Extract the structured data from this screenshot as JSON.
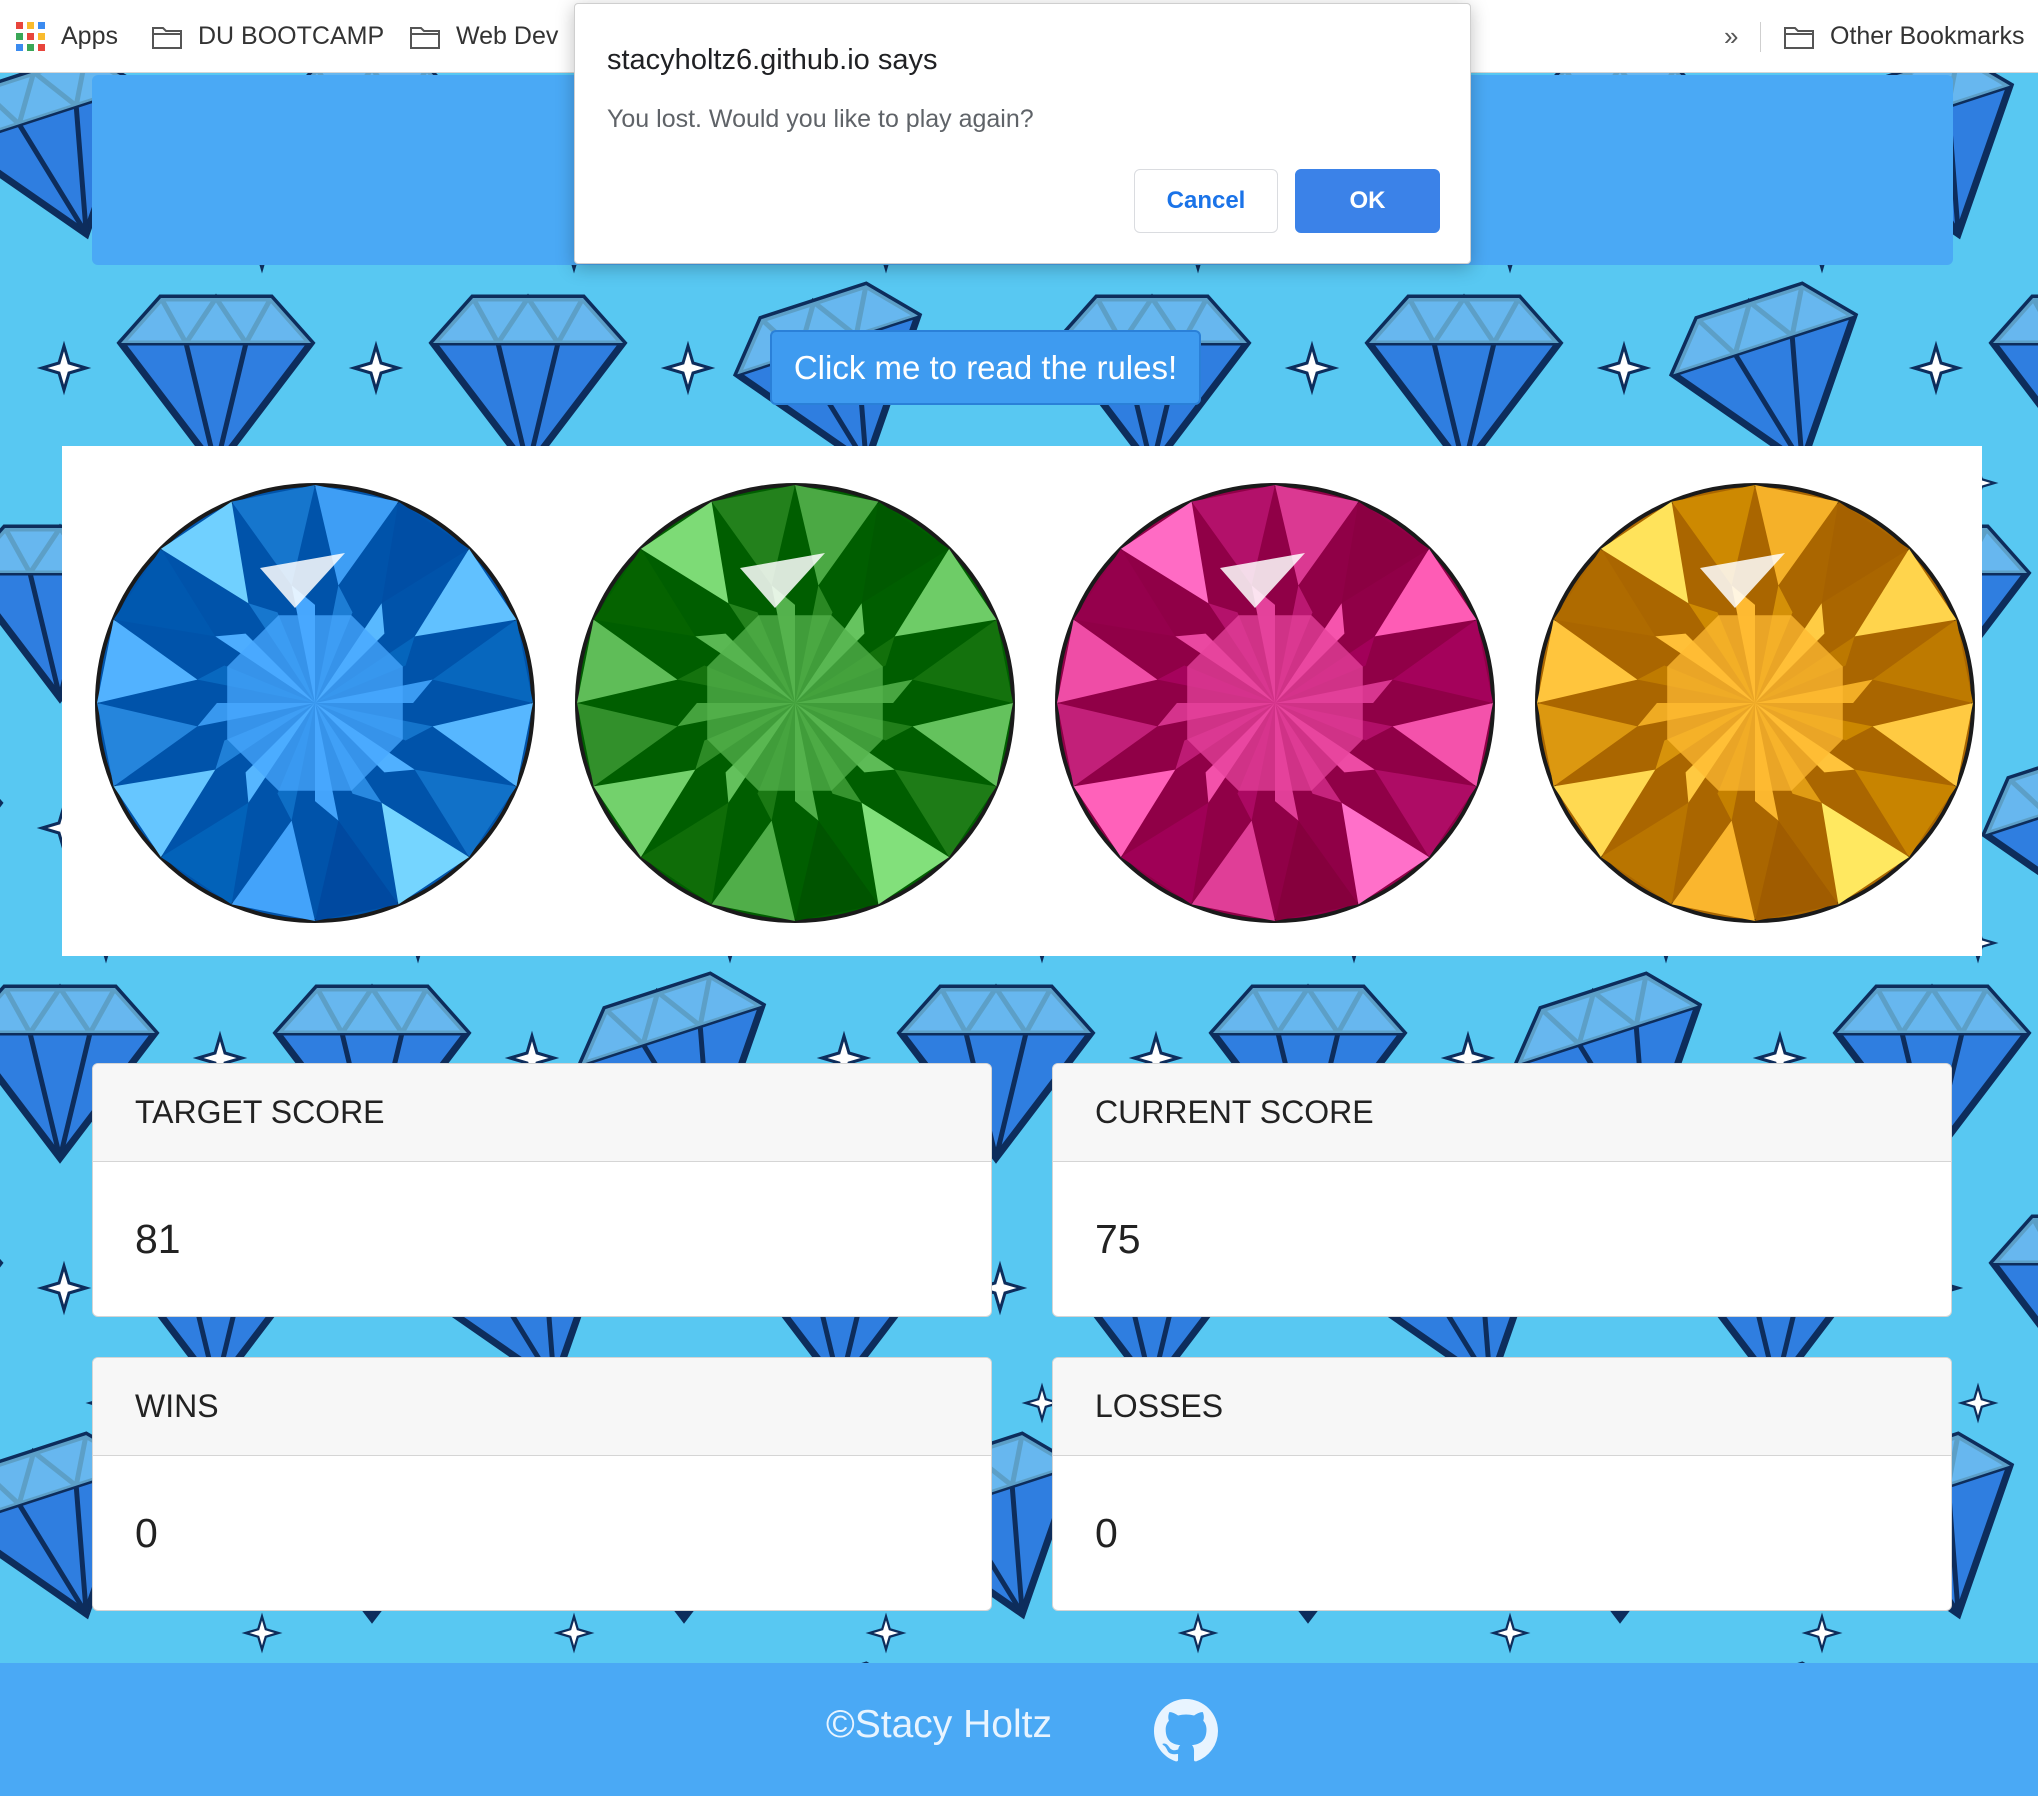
{
  "bookmarks": {
    "apps_label": "Apps",
    "folders": [
      "DU BOOTCAMP",
      "Web Dev"
    ],
    "overflow_label": "»",
    "other_label": "Other Bookmarks"
  },
  "dialog": {
    "title": "stacyholtz6.github.io says",
    "message": "You lost. Would you like to play again?",
    "cancel_label": "Cancel",
    "ok_label": "OK"
  },
  "rules_button_label": "Click me to read the rules!",
  "gems": [
    {
      "name": "blue",
      "color": "#2f8fe6"
    },
    {
      "name": "green",
      "color": "#3c9a35"
    },
    {
      "name": "pink",
      "color": "#cc2a83"
    },
    {
      "name": "yellow",
      "color": "#e6a21a"
    }
  ],
  "cards": {
    "target": {
      "label": "TARGET SCORE",
      "value": "81"
    },
    "current": {
      "label": "CURRENT SCORE",
      "value": "75"
    },
    "wins": {
      "label": "WINS",
      "value": "0"
    },
    "losses": {
      "label": "LOSSES",
      "value": "0"
    }
  },
  "footer": {
    "copyright": "©Stacy Holtz",
    "icon": "github-icon"
  },
  "colors": {
    "background": "#58c8f2",
    "header": "#4aa9f5",
    "rules_button": "#3e9bf0",
    "dialog_ok": "#3b82e8"
  }
}
